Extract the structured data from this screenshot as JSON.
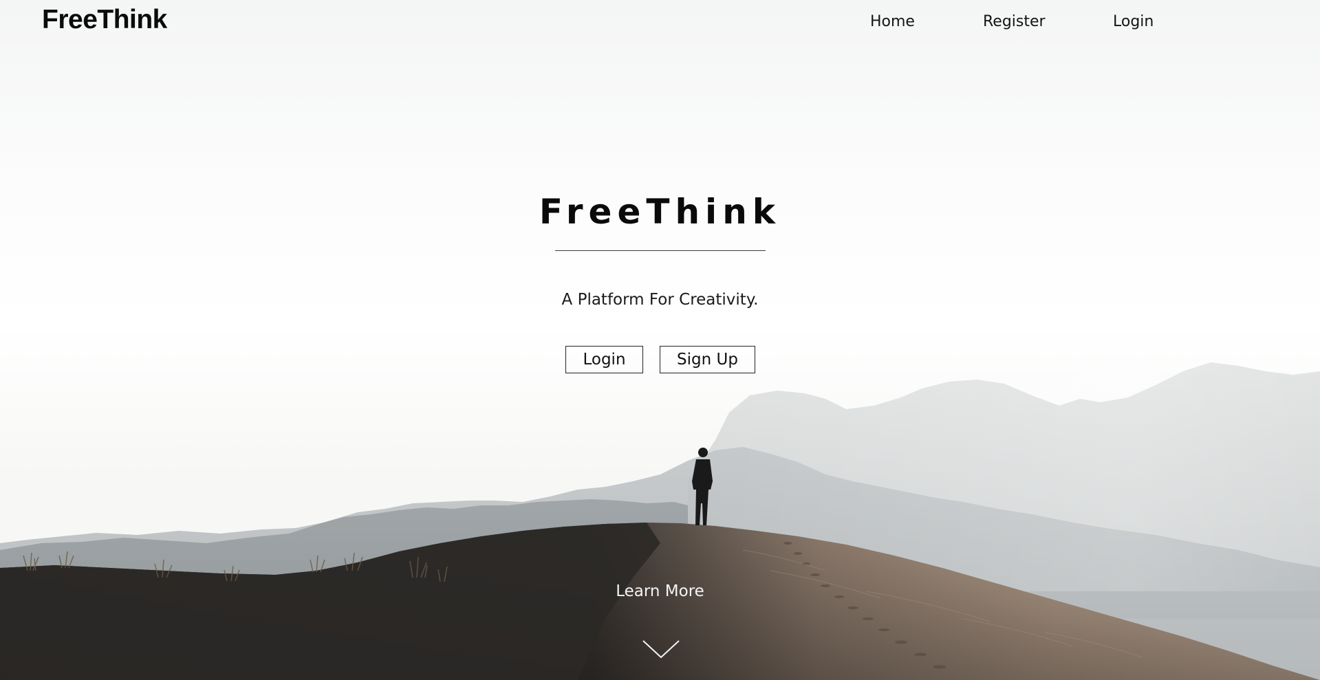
{
  "brand": "FreeThink",
  "nav": {
    "links": [
      "Home",
      "Register",
      "Login"
    ]
  },
  "hero": {
    "title": "FreeThink",
    "tagline": "A Platform For Creativity.",
    "login_label": "Login",
    "signup_label": "Sign Up",
    "learn_more": "Learn More"
  },
  "colors": {
    "text": "#111111",
    "sand_shadow": "#2a2826",
    "sand_light": "#b8a290",
    "mountains": "#9ca1a3",
    "sky": "#fbfbfb"
  },
  "icons": {
    "scroll_down": "chevron-down-icon"
  }
}
